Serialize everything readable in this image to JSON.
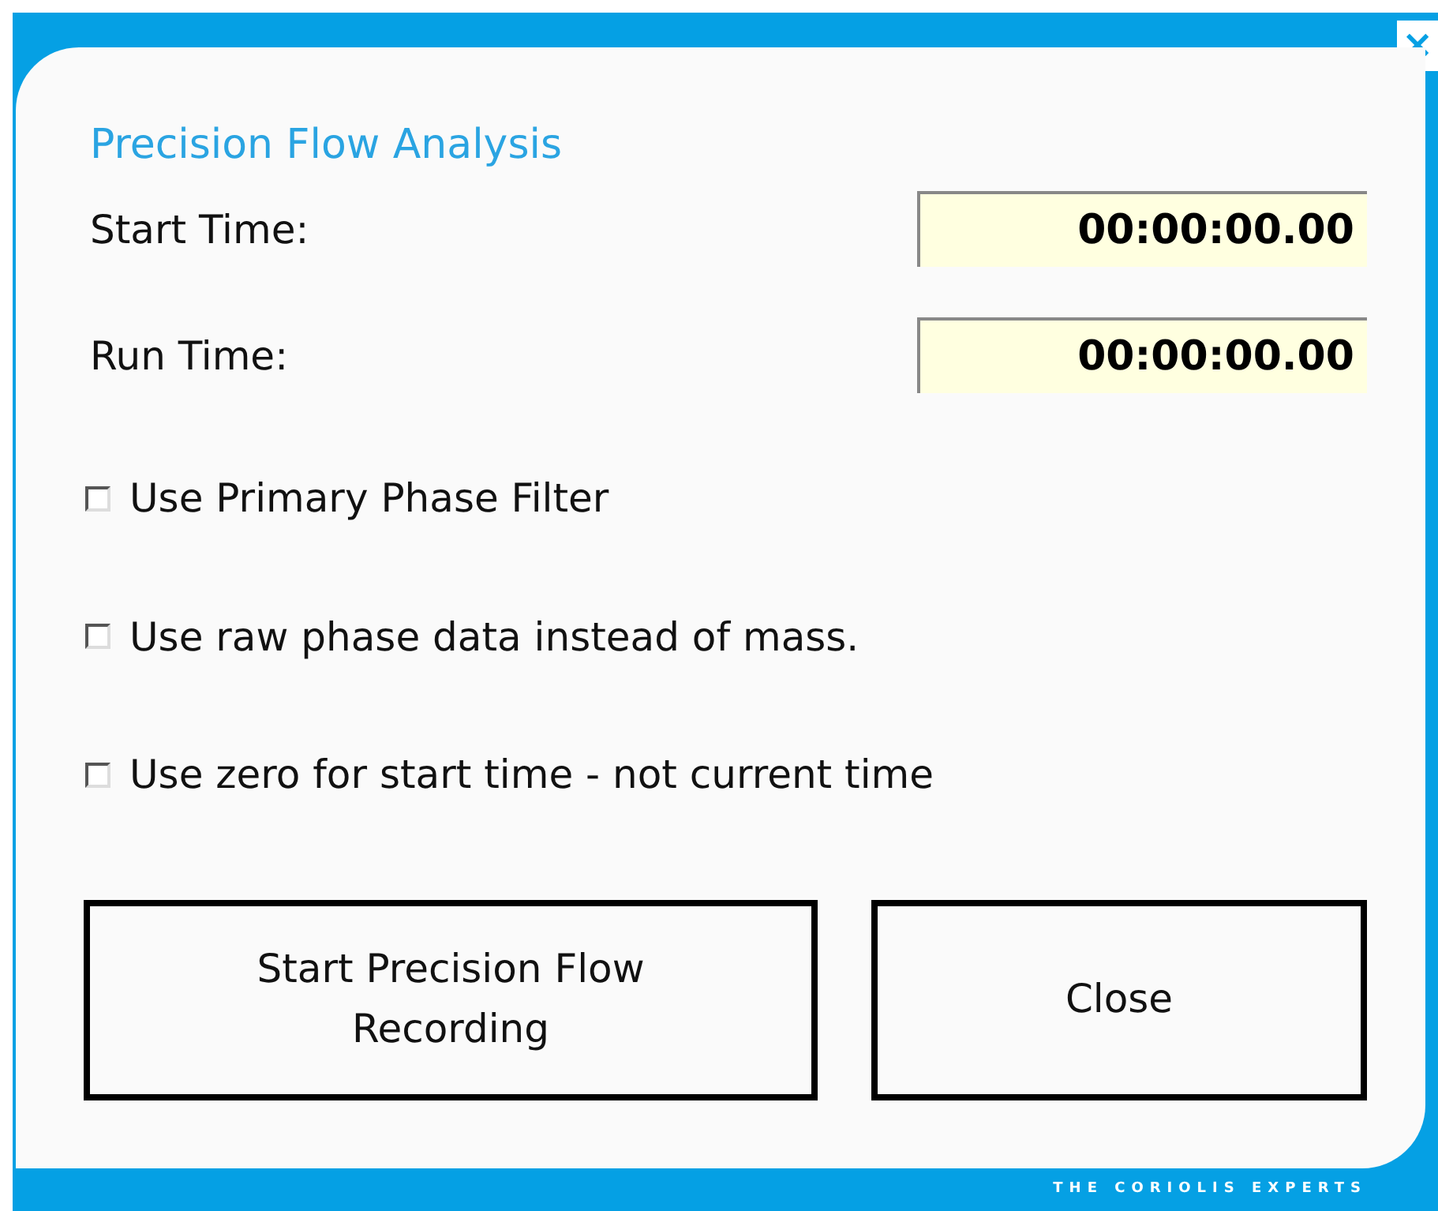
{
  "window": {
    "close": "×"
  },
  "title": "Precision Flow Analysis",
  "fields": [
    {
      "label": "Start Time:",
      "value": "00:00:00.00"
    },
    {
      "label": "Run Time:",
      "value": "00:00:00.00"
    }
  ],
  "options": [
    {
      "label": "Use Primary Phase Filter",
      "checked": false
    },
    {
      "label": "Use raw phase data instead of mass.",
      "checked": false
    },
    {
      "label": "Use zero for start time - not current time",
      "checked": false
    }
  ],
  "buttons": [
    {
      "label": "Start Precision Flow Recording"
    },
    {
      "label": "Close"
    }
  ],
  "footer": "THE CORIOLIS EXPERTS"
}
